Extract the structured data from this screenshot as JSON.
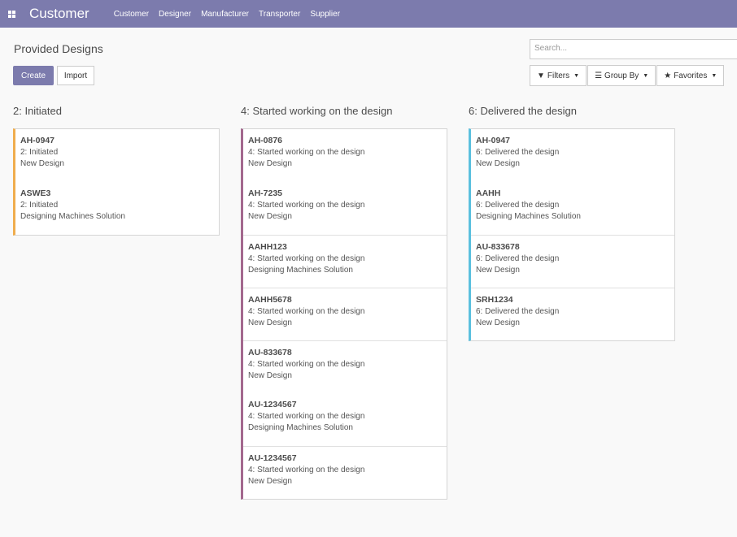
{
  "app": {
    "brand": "Customer",
    "menu": [
      "Customer",
      "Designer",
      "Manufacturer",
      "Transporter",
      "Supplier"
    ]
  },
  "control": {
    "breadcrumb": "Provided Designs",
    "search_placeholder": "Search...",
    "create_label": "Create",
    "import_label": "Import",
    "filters_label": "Filters",
    "groupby_label": "Group By",
    "favorites_label": "Favorites"
  },
  "colors": {
    "primary": "#7c7bad",
    "initiated": "#f0ad4e",
    "started": "#a3688e",
    "delivered": "#5bc0de"
  },
  "columns": [
    {
      "title": "2: Initiated",
      "cards": [
        {
          "ref": "AH-0947",
          "stage": "2: Initiated",
          "type": "New Design"
        },
        {
          "ref": "ASWE3",
          "stage": "2: Initiated",
          "type": "Designing Machines Solution"
        }
      ]
    },
    {
      "title": "4: Started working on the design",
      "cards": [
        {
          "ref": "AH-0876",
          "stage": "4: Started working on the design",
          "type": "New Design"
        },
        {
          "ref": "AH-7235",
          "stage": "4: Started working on the design",
          "type": "New Design"
        },
        {
          "ref": "AAHH123",
          "stage": "4: Started working on the design",
          "type": "Designing Machines Solution"
        },
        {
          "ref": "AAHH5678",
          "stage": "4: Started working on the design",
          "type": "New Design"
        },
        {
          "ref": "AU-833678",
          "stage": "4: Started working on the design",
          "type": "New Design"
        },
        {
          "ref": "AU-1234567",
          "stage": "4: Started working on the design",
          "type": "Designing Machines Solution"
        },
        {
          "ref": "AU-1234567",
          "stage": "4: Started working on the design",
          "type": "New Design"
        }
      ]
    },
    {
      "title": "6: Delivered the design",
      "cards": [
        {
          "ref": "AH-0947",
          "stage": "6: Delivered the design",
          "type": "New Design"
        },
        {
          "ref": "AAHH",
          "stage": "6: Delivered the design",
          "type": "Designing Machines Solution"
        },
        {
          "ref": "AU-833678",
          "stage": "6: Delivered the design",
          "type": "New Design"
        },
        {
          "ref": "SRH1234",
          "stage": "6: Delivered the design",
          "type": "New Design"
        }
      ]
    }
  ]
}
